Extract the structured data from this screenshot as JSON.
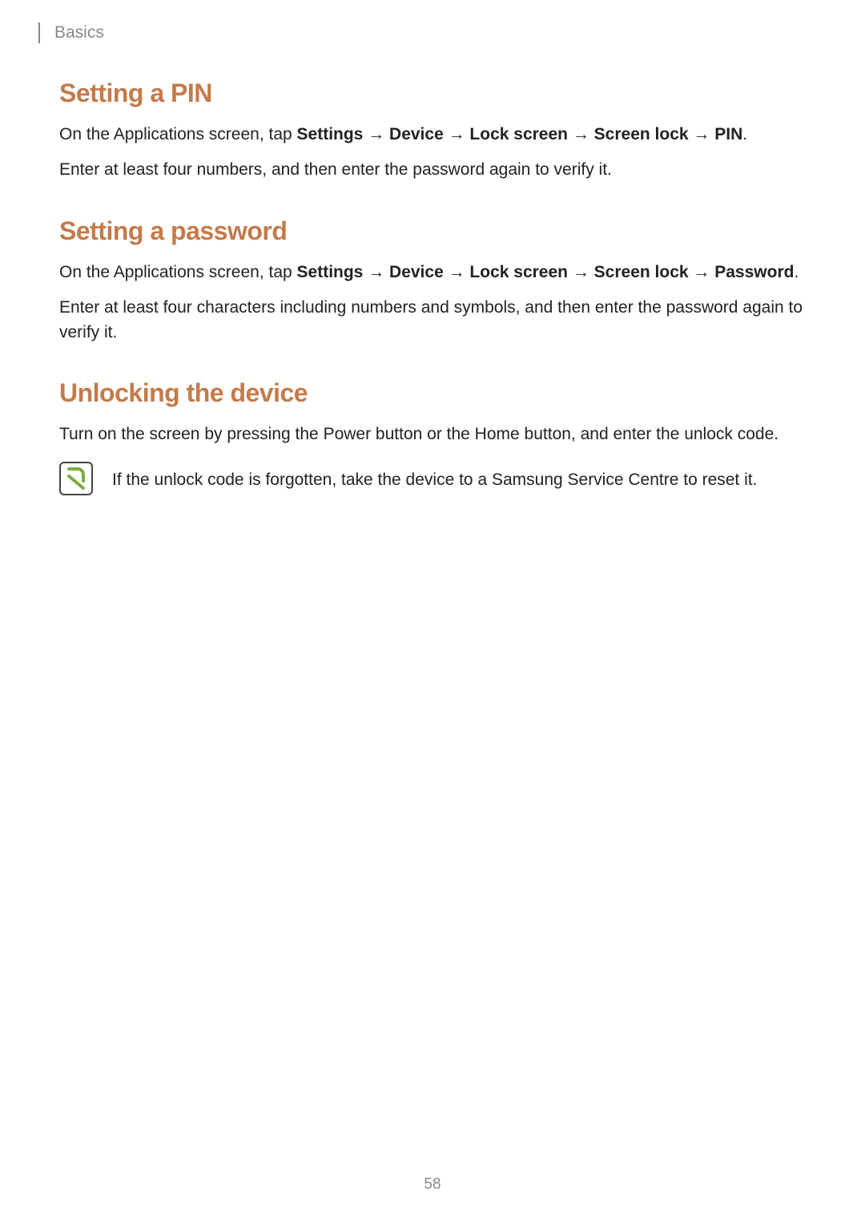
{
  "header": {
    "section_label": "Basics"
  },
  "sections": {
    "pin": {
      "heading": "Setting a PIN",
      "intro_prefix": "On the Applications screen, tap ",
      "nav1": "Settings",
      "arrow": " → ",
      "nav2": "Device",
      "nav3": "Lock screen",
      "nav4": "Screen lock",
      "nav5": "PIN",
      "period": ".",
      "body2": "Enter at least four numbers, and then enter the password again to verify it."
    },
    "password": {
      "heading": "Setting a password",
      "intro_prefix": "On the Applications screen, tap ",
      "nav1": "Settings",
      "arrow": " → ",
      "nav2": "Device",
      "nav3": "Lock screen",
      "nav4": "Screen lock",
      "arrow_trail": " → ",
      "nav5": "Password",
      "period": ".",
      "body2": "Enter at least four characters including numbers and symbols, and then enter the password again to verify it."
    },
    "unlock": {
      "heading": "Unlocking the device",
      "body1": "Turn on the screen by pressing the Power button or the Home button, and enter the unlock code.",
      "note": "If the unlock code is forgotten, take the device to a Samsung Service Centre to reset it."
    }
  },
  "page_number": "58"
}
